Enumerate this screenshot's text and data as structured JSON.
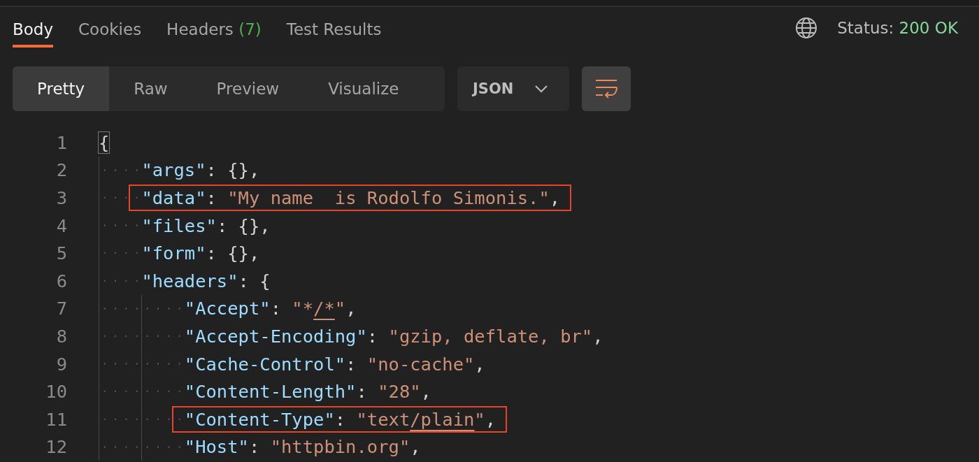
{
  "tabs": [
    {
      "label": "Body",
      "selected": true
    },
    {
      "label": "Cookies",
      "selected": false
    },
    {
      "label": "Headers",
      "count": "(7)",
      "selected": false
    },
    {
      "label": "Test Results",
      "selected": false
    }
  ],
  "status": {
    "label": "Status:",
    "value": "200 OK"
  },
  "view_modes": [
    {
      "label": "Pretty",
      "selected": true
    },
    {
      "label": "Raw",
      "selected": false
    },
    {
      "label": "Preview",
      "selected": false
    },
    {
      "label": "Visualize",
      "selected": false
    }
  ],
  "format_dropdown": {
    "value": "JSON"
  },
  "wrap_button": {
    "on": true
  },
  "code_lines": [
    {
      "number": "1",
      "highlighted": false,
      "tokens": [
        {
          "kind": "brace-match",
          "text": "{"
        }
      ],
      "children": [
        {
          "number": "2",
          "highlighted": false,
          "tokens": [
            {
              "kind": "key",
              "text": "\"args\""
            },
            {
              "kind": "punct",
              "text": ": {},"
            }
          ]
        },
        {
          "number": "3",
          "highlighted": true,
          "tokens": [
            {
              "kind": "key",
              "text": "\"data\""
            },
            {
              "kind": "punct",
              "text": ": "
            },
            {
              "kind": "string",
              "text": "\"My name  is Rodolfo Simonis.\""
            },
            {
              "kind": "punct",
              "text": ","
            }
          ]
        },
        {
          "number": "4",
          "highlighted": false,
          "tokens": [
            {
              "kind": "key",
              "text": "\"files\""
            },
            {
              "kind": "punct",
              "text": ": {},"
            }
          ]
        },
        {
          "number": "5",
          "highlighted": false,
          "tokens": [
            {
              "kind": "key",
              "text": "\"form\""
            },
            {
              "kind": "punct",
              "text": ": {},"
            }
          ]
        },
        {
          "number": "6",
          "highlighted": false,
          "tokens": [
            {
              "kind": "key",
              "text": "\"headers\""
            },
            {
              "kind": "punct",
              "text": ": {"
            }
          ],
          "children": [
            {
              "number": "7",
              "highlighted": false,
              "tokens": [
                {
                  "kind": "key",
                  "text": "\"Accept\""
                },
                {
                  "kind": "punct",
                  "text": ": "
                },
                {
                  "kind": "string",
                  "text": "\"*"
                },
                {
                  "kind": "link",
                  "text": "/*"
                },
                {
                  "kind": "string",
                  "text": "\""
                },
                {
                  "kind": "punct",
                  "text": ","
                }
              ]
            },
            {
              "number": "8",
              "highlighted": false,
              "tokens": [
                {
                  "kind": "key",
                  "text": "\"Accept-Encoding\""
                },
                {
                  "kind": "punct",
                  "text": ": "
                },
                {
                  "kind": "string",
                  "text": "\"gzip, deflate, br\""
                },
                {
                  "kind": "punct",
                  "text": ","
                }
              ]
            },
            {
              "number": "9",
              "highlighted": false,
              "tokens": [
                {
                  "kind": "key",
                  "text": "\"Cache-Control\""
                },
                {
                  "kind": "punct",
                  "text": ": "
                },
                {
                  "kind": "string",
                  "text": "\"no-cache\""
                },
                {
                  "kind": "punct",
                  "text": ","
                }
              ]
            },
            {
              "number": "10",
              "highlighted": false,
              "tokens": [
                {
                  "kind": "key",
                  "text": "\"Content-Length\""
                },
                {
                  "kind": "punct",
                  "text": ": "
                },
                {
                  "kind": "string",
                  "text": "\"28\""
                },
                {
                  "kind": "punct",
                  "text": ","
                }
              ]
            },
            {
              "number": "11",
              "highlighted": true,
              "tokens": [
                {
                  "kind": "key",
                  "text": "\"Content-Type\""
                },
                {
                  "kind": "punct",
                  "text": ": "
                },
                {
                  "kind": "string",
                  "text": "\"text"
                },
                {
                  "kind": "link",
                  "text": "/plain"
                },
                {
                  "kind": "string",
                  "text": "\""
                },
                {
                  "kind": "punct",
                  "text": ","
                }
              ]
            },
            {
              "number": "12",
              "highlighted": false,
              "tokens": [
                {
                  "kind": "key",
                  "text": "\"Host\""
                },
                {
                  "kind": "punct",
                  "text": ": "
                },
                {
                  "kind": "string",
                  "text": "\"httpbin.org\""
                },
                {
                  "kind": "punct",
                  "text": ","
                }
              ]
            }
          ]
        }
      ]
    }
  ]
}
